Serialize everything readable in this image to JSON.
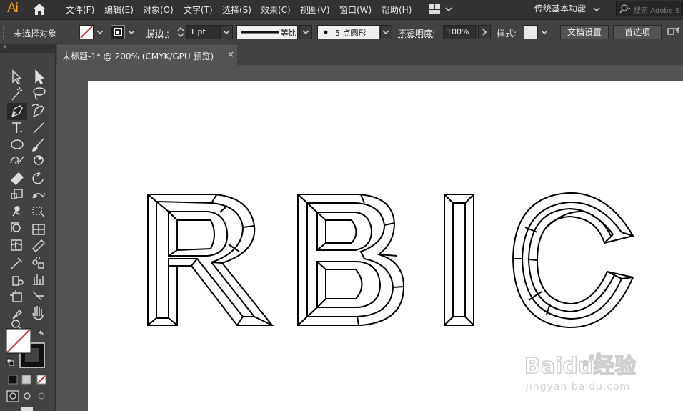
{
  "app": {
    "logo": "Ai",
    "home_icon": "home-icon"
  },
  "menu": [
    "文件(F)",
    "编辑(E)",
    "对象(O)",
    "文字(T)",
    "选择(S)",
    "效果(C)",
    "视图(V)",
    "窗口(W)",
    "帮助(H)"
  ],
  "workspace": {
    "label": "传统基本功能"
  },
  "search": {
    "placeholder": "搜索 Adobe S"
  },
  "control": {
    "selection_status": "未选择对象",
    "stroke_label": "描边",
    "stroke_weight": "1 pt",
    "stroke_profile": "等比",
    "brush": "5 点圆形",
    "opacity_label": "不透明度",
    "opacity_value": "100%",
    "style_label": "样式",
    "doc_setup": "文档设置",
    "preferences": "首选项"
  },
  "document": {
    "tab_title": "未标题-1* @ 200% (CMYK/GPU 预览)",
    "close": "×"
  },
  "artwork": {
    "letters": [
      "R",
      "B",
      "I",
      "C"
    ]
  },
  "watermark": {
    "brand": "Baidu经验",
    "url": "jingyan.baidu.com"
  },
  "colors": {
    "accent": "#ff9a00",
    "stroke_none_red": "#d0342c",
    "panel_bg": "#424242",
    "menubar_bg": "#323232",
    "canvas_bg": "#535353"
  }
}
